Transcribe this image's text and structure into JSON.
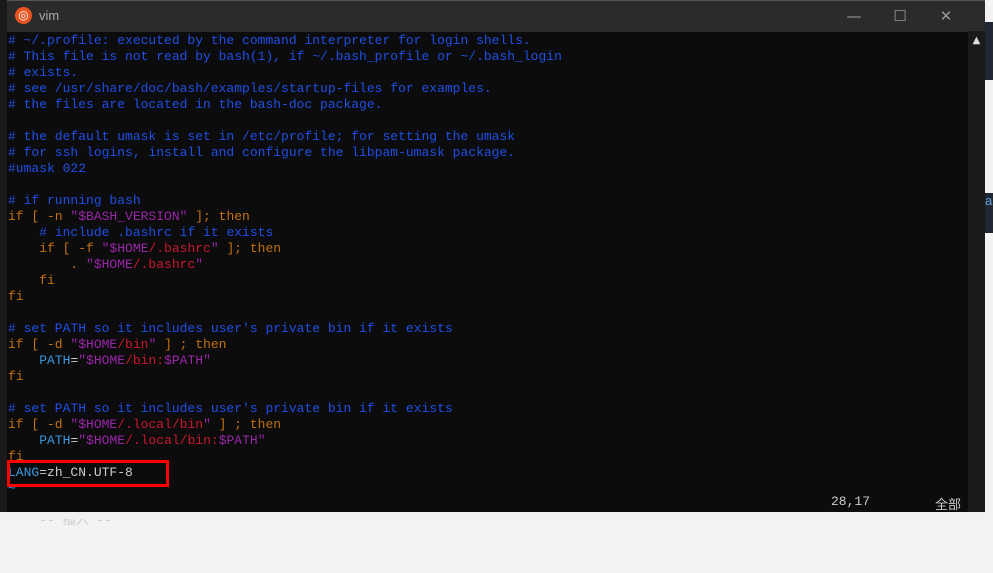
{
  "window": {
    "title": "vim",
    "app_icon": "ubuntu-icon",
    "controls": {
      "minimize": "—",
      "maximize": "☐",
      "close": "✕"
    }
  },
  "colors": {
    "comment": "#1f4fe6",
    "keyword": "#c57012",
    "string": "#9a26aa",
    "path": "#c8182e",
    "variable": "#3a96dd",
    "highlight_box": "#ff0000"
  },
  "lines": [
    [
      [
        "c",
        "# ~/.profile: executed by the command interpreter for login shells."
      ]
    ],
    [
      [
        "c",
        "# This file is not read by bash(1), if ~/.bash_profile or ~/.bash_login"
      ]
    ],
    [
      [
        "c",
        "# exists."
      ]
    ],
    [
      [
        "c",
        "# see /usr/share/doc/bash/examples/startup-files for examples."
      ]
    ],
    [
      [
        "c",
        "# the files are located in the bash-doc package."
      ]
    ],
    [],
    [
      [
        "c",
        "# the default umask is set in /etc/profile; for setting the umask"
      ]
    ],
    [
      [
        "c",
        "# for ssh logins, install and configure the libpam-umask package."
      ]
    ],
    [
      [
        "c",
        "#umask 022"
      ]
    ],
    [],
    [
      [
        "c",
        "# if running bash"
      ]
    ],
    [
      [
        "k",
        "if [ -n "
      ],
      [
        "s",
        "\"$BASH_VERSION\""
      ],
      [
        "k",
        " ]; then"
      ]
    ],
    [
      [
        "t",
        "    "
      ],
      [
        "c",
        "# include .bashrc if it exists"
      ]
    ],
    [
      [
        "k",
        "    if [ -f "
      ],
      [
        "s",
        "\"$HOME"
      ],
      [
        "r",
        "/.bashrc"
      ],
      [
        "s",
        "\""
      ],
      [
        "k",
        " ]; then"
      ]
    ],
    [
      [
        "k",
        "        . "
      ],
      [
        "s",
        "\"$HOME"
      ],
      [
        "r",
        "/.bashrc"
      ],
      [
        "s",
        "\""
      ]
    ],
    [
      [
        "k",
        "    fi"
      ]
    ],
    [
      [
        "k",
        "fi"
      ]
    ],
    [],
    [
      [
        "c",
        "# set PATH so it includes user's private bin if it exists"
      ]
    ],
    [
      [
        "k",
        "if [ -d "
      ],
      [
        "s",
        "\"$HOME"
      ],
      [
        "r",
        "/bin"
      ],
      [
        "s",
        "\""
      ],
      [
        "k",
        " ] ; then"
      ]
    ],
    [
      [
        "t",
        "    "
      ],
      [
        "v",
        "PATH"
      ],
      [
        "t",
        "="
      ],
      [
        "s",
        "\"$HOME"
      ],
      [
        "r",
        "/bin:"
      ],
      [
        "s",
        "$PATH\""
      ]
    ],
    [
      [
        "k",
        "fi"
      ]
    ],
    [],
    [
      [
        "c",
        "# set PATH so it includes user's private bin if it exists"
      ]
    ],
    [
      [
        "k",
        "if [ -d "
      ],
      [
        "s",
        "\"$HOME"
      ],
      [
        "r",
        "/.local/bin"
      ],
      [
        "s",
        "\""
      ],
      [
        "k",
        " ] ; then"
      ]
    ],
    [
      [
        "t",
        "    "
      ],
      [
        "v",
        "PATH"
      ],
      [
        "t",
        "="
      ],
      [
        "s",
        "\"$HOME"
      ],
      [
        "r",
        "/.local/bin:"
      ],
      [
        "s",
        "$PATH\""
      ]
    ],
    [
      [
        "k",
        "fi"
      ]
    ],
    [
      [
        "v",
        "LANG"
      ],
      [
        "t",
        "=zh_CN.UTF-8"
      ]
    ],
    [
      [
        "v",
        "~"
      ]
    ]
  ],
  "status": {
    "mode": "-- 插入 --",
    "position": "28,17",
    "scroll": "全部"
  },
  "behind_window_text": "a"
}
